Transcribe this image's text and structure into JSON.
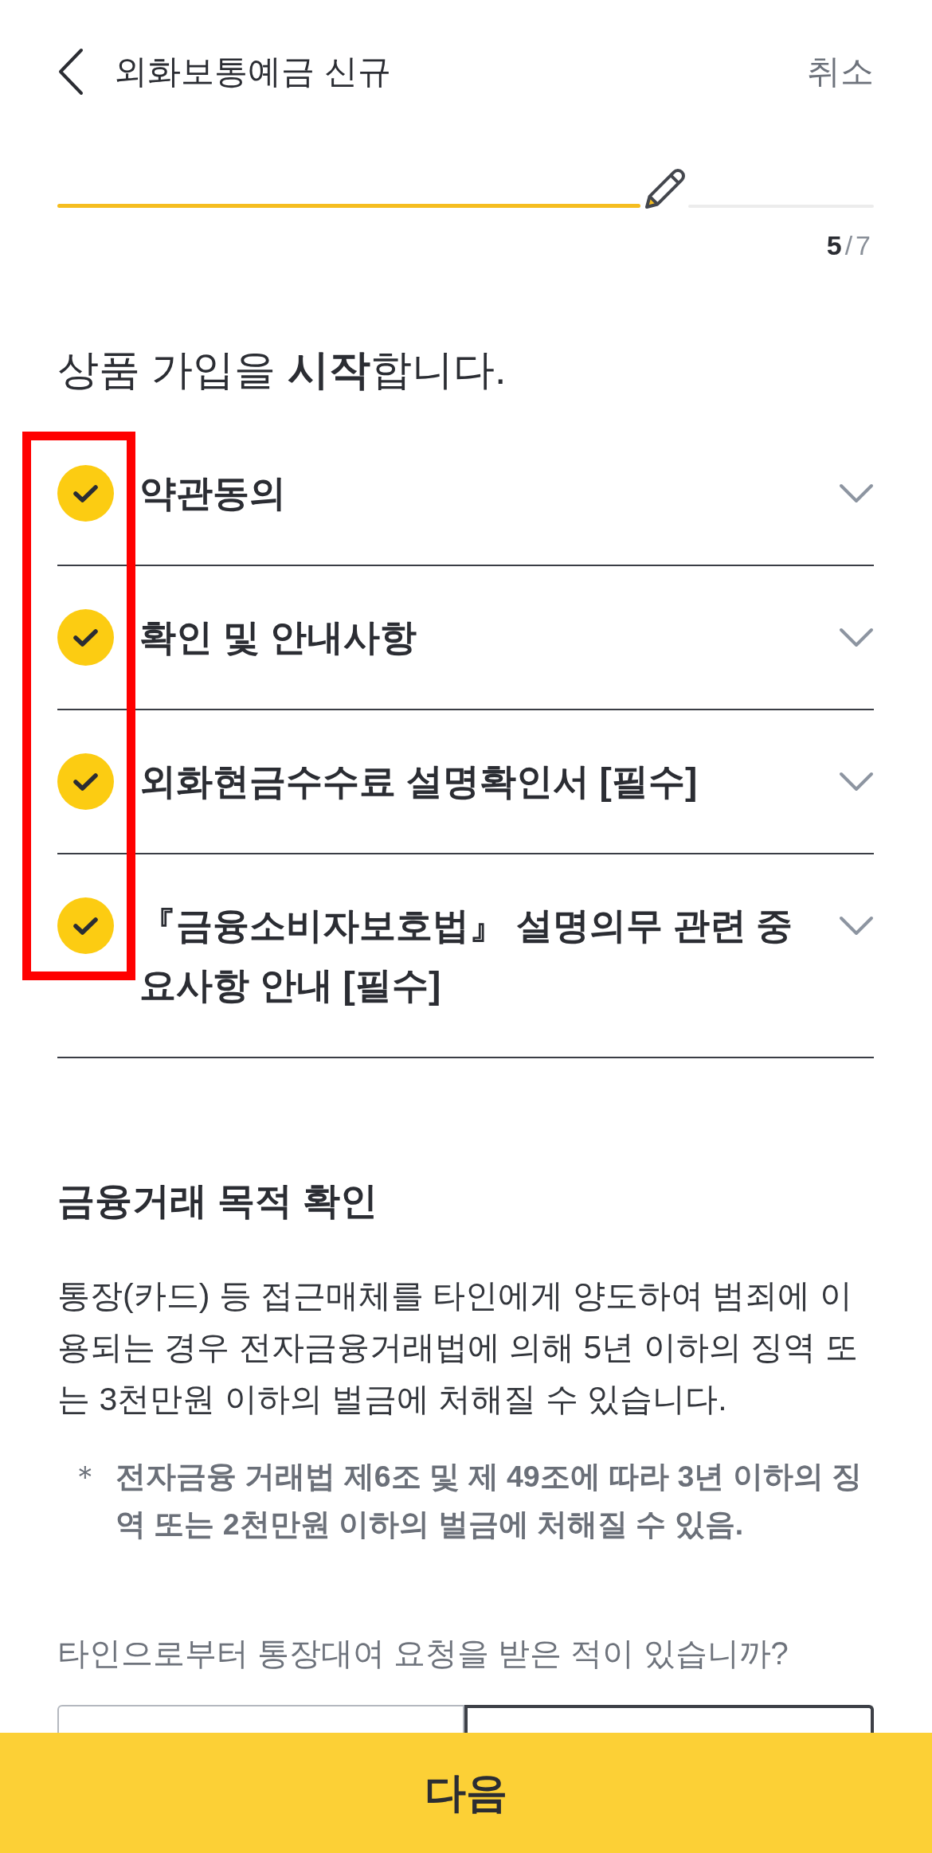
{
  "header": {
    "title": "외화보통예금 신규",
    "cancel": "취소"
  },
  "progress": {
    "level": 0.714,
    "current": "5",
    "total": "/7"
  },
  "heading": "상품 가입을 **시작**합니다.",
  "checklist": [
    {
      "label": "약관동의",
      "checked": true,
      "expanded": false
    },
    {
      "label": "확인 및 안내사항",
      "checked": true,
      "expanded": false
    },
    {
      "label": "외화현금수수료 설명확인서 [필수]",
      "checked": true,
      "expanded": false
    },
    {
      "label": "『금융소비자보호법』 설명의무 관련 중요사항 안내 [필수]",
      "checked": true,
      "expanded": false
    }
  ],
  "highlight": {
    "kind": "rectangle"
  },
  "purpose": {
    "title": "금융거래 목적 확인",
    "body": "통장(카드) 등 접근매체를 타인에게 양도하여 범죄에 이용되는 경우 전자금융거래법에 의해 5년 이하의 징역 또는 3천만원 이하의 벌금에 처해질 수 있습니다.",
    "note_mark": "＊",
    "note": "전자금융 거래법 제6조 및 제 49조에 따라 3년 이하의 징역 또는 2천만원 이하의 벌금에 처해질 수 있음."
  },
  "question": {
    "text": "타인으로부터 통장대여 요청을 받은 적이 있습니까?",
    "options": [
      {
        "selected": false
      },
      {
        "selected": true
      }
    ]
  },
  "next_button": "다음"
}
